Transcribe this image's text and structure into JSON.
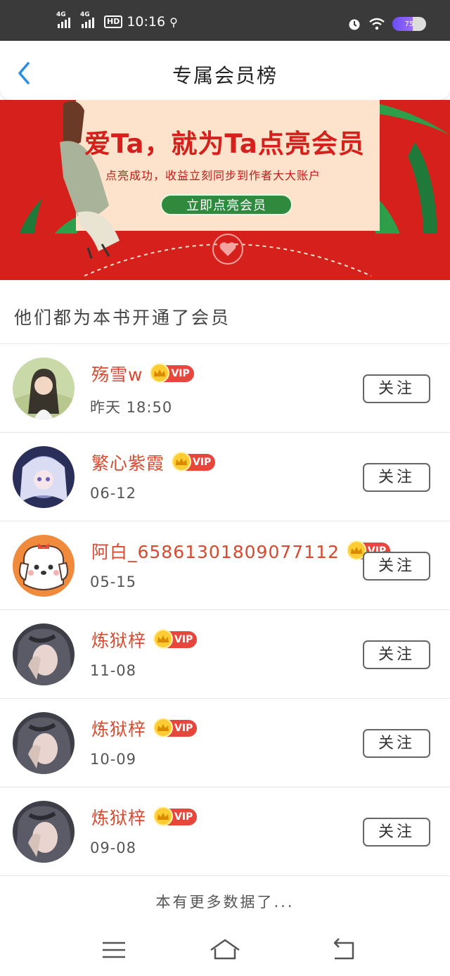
{
  "status_bar": {
    "net1": "4G",
    "net2": "4G",
    "hd": "HD",
    "time": "10:16",
    "battery": "75"
  },
  "header": {
    "title": "专属会员榜"
  },
  "banner": {
    "title": "爱Ta，就为Ta点亮会员",
    "subtitle": "点亮成功，收益立刻同步到作者大大账户",
    "button_label": "立即点亮会员"
  },
  "section": {
    "title": "他们都为本书开通了会员"
  },
  "members": [
    {
      "name": "殇雪w",
      "date": "昨天 18:50",
      "badge": "VIP",
      "follow": "关注"
    },
    {
      "name": "繁心紫霞",
      "date": "06-12",
      "badge": "VIP",
      "follow": "关注"
    },
    {
      "name": "阿白_65861301809077112",
      "date": "05-15",
      "badge": "VIP",
      "follow": "关注"
    },
    {
      "name": "炼狱梓",
      "date": "11-08",
      "badge": "VIP",
      "follow": "关注"
    },
    {
      "name": "炼狱梓",
      "date": "10-09",
      "badge": "VIP",
      "follow": "关注"
    },
    {
      "name": "炼狱梓",
      "date": "09-08",
      "badge": "VIP",
      "follow": "关注"
    }
  ],
  "footer": {
    "note": "本有更多数据了..."
  },
  "colors": {
    "accent_blue": "#2a8ee8",
    "name_red": "#d84a30",
    "banner_red": "#d6201c",
    "vip_red": "#e8453c",
    "crown_gold": "#ffcc33"
  },
  "icons": {
    "back": "chevron-left-icon",
    "crown": "crown-icon",
    "menu": "menu-icon",
    "home": "home-icon",
    "return": "back-arrow-icon"
  }
}
